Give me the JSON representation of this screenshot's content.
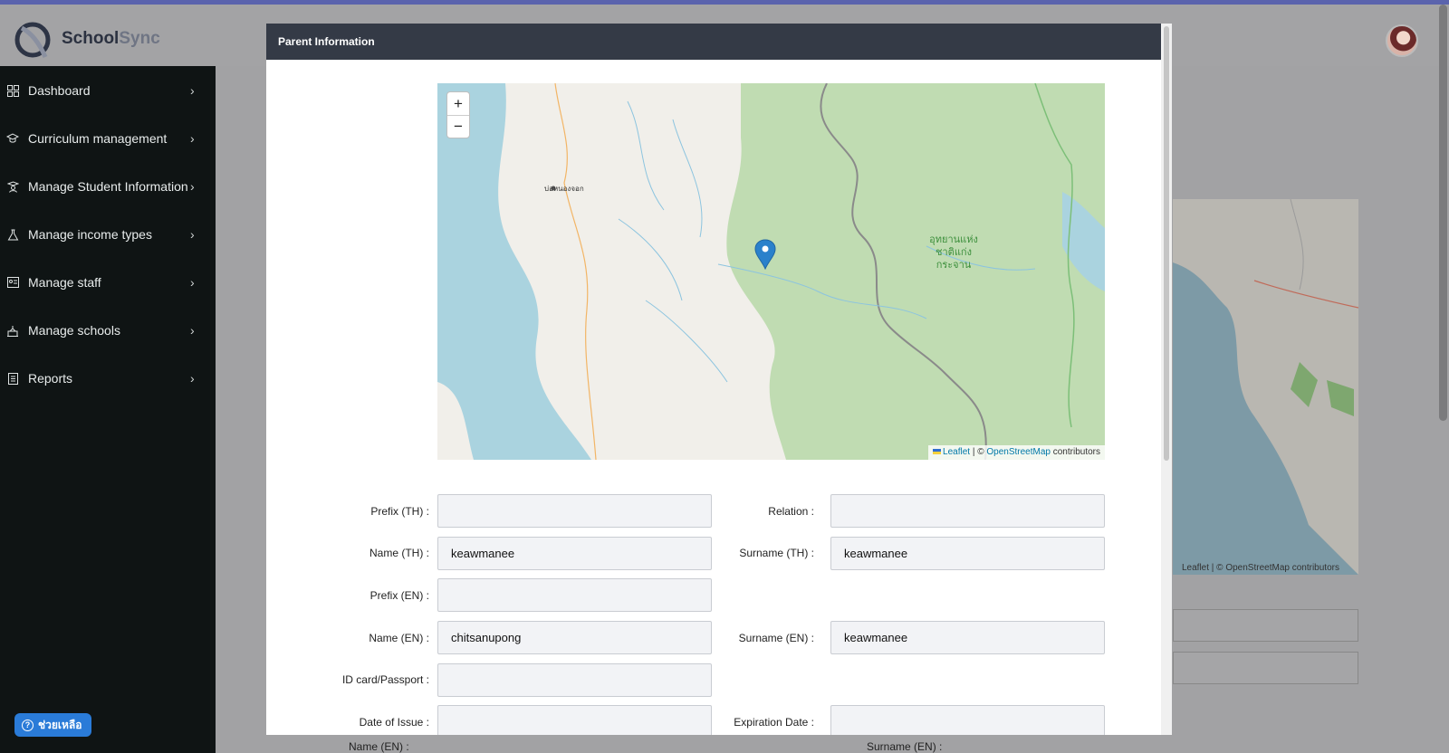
{
  "app": {
    "brand_primary": "School",
    "brand_secondary": "Sync"
  },
  "sidebar": {
    "items": [
      {
        "label": "Dashboard",
        "icon": "grid-icon"
      },
      {
        "label": "Curriculum management",
        "icon": "graduation-cap-icon"
      },
      {
        "label": "Manage Student Information",
        "icon": "student-icon"
      },
      {
        "label": "Manage income types",
        "icon": "flask-icon"
      },
      {
        "label": "Manage staff",
        "icon": "id-card-icon"
      },
      {
        "label": "Manage schools",
        "icon": "school-icon"
      },
      {
        "label": "Reports",
        "icon": "report-icon"
      }
    ]
  },
  "help": {
    "label": "ช่วยเหลือ"
  },
  "background": {
    "attribution_leaflet": "Leaflet",
    "attribution_sep": " | © ",
    "attribution_osm": "OpenStreetMap",
    "attribution_tail": " contributors",
    "label_name_en": "Name (EN) :",
    "label_surname_en": "Surname (EN) :"
  },
  "modal": {
    "title": "Parent Information",
    "map": {
      "zoom_in": "+",
      "zoom_out": "−",
      "park_label": [
        "อุทยานแห่ง",
        "ชาติแก่ง",
        "กระจาน"
      ],
      "town_label": "บ่อหนองจอก",
      "attribution_leaflet": "Leaflet",
      "attribution_sep": " | © ",
      "attribution_osm": "OpenStreetMap",
      "attribution_tail": " contributors"
    },
    "fields": {
      "prefix_th": {
        "label": "Prefix (TH) :",
        "value": ""
      },
      "relation": {
        "label": "Relation :",
        "value": ""
      },
      "name_th": {
        "label": "Name (TH) :",
        "value": "keawmanee"
      },
      "surname_th": {
        "label": "Surname (TH) :",
        "value": "keawmanee"
      },
      "prefix_en": {
        "label": "Prefix (EN) :",
        "value": ""
      },
      "name_en": {
        "label": "Name (EN) :",
        "value": "chitsanupong"
      },
      "surname_en": {
        "label": "Surname (EN) :",
        "value": "keawmanee"
      },
      "id_card": {
        "label": "ID card/Passport :",
        "value": ""
      },
      "date_issue": {
        "label": "Date of Issue :",
        "value": ""
      },
      "expiration": {
        "label": "Expiration Date :",
        "value": ""
      }
    }
  },
  "colors": {
    "sidebar_bg": "#0f1414",
    "header_bg": "#343a46",
    "accent": "#2a7bd8",
    "top_stripe": "#5a63ad"
  }
}
